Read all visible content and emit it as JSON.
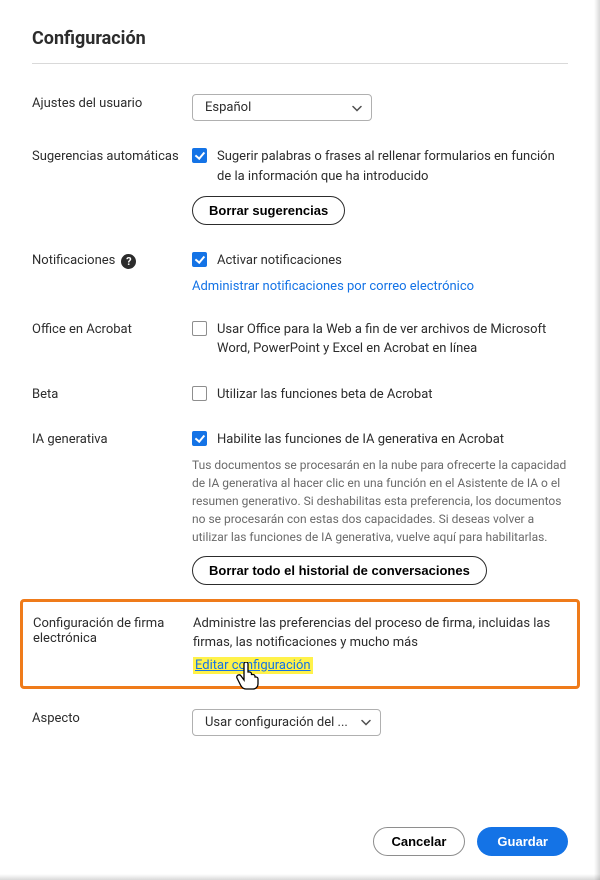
{
  "title": "Configuración",
  "userSettings": {
    "label": "Ajustes del usuario",
    "selected": "Español"
  },
  "autoSuggest": {
    "label": "Sugerencias automáticas",
    "checkboxLabel": "Sugerir palabras o frases al rellenar formularios en función de la información que ha introducido",
    "clearButton": "Borrar sugerencias"
  },
  "notifications": {
    "label": "Notificaciones",
    "checkboxLabel": "Activar notificaciones",
    "manageLink": "Administrar notificaciones por correo electrónico"
  },
  "office": {
    "label": "Office en Acrobat",
    "checkboxLabel": "Usar Office para la Web a fin de ver archivos de Microsoft Word, PowerPoint y Excel en Acrobat en línea"
  },
  "beta": {
    "label": "Beta",
    "checkboxLabel": "Utilizar las funciones beta de Acrobat"
  },
  "genAI": {
    "label": "IA generativa",
    "checkboxLabel": "Habilite las funciones de IA generativa en Acrobat",
    "description": "Tus documentos se procesarán en la nube para ofrecerte la capacidad de IA generativa al hacer clic en una función en el Asistente de IA o el resumen generativo. Si deshabilitas esta preferencia, los documentos no se procesarán con estas dos capacidades. Si deseas volver a utilizar las funciones de IA generativa, vuelve aquí para habilitarlas.",
    "clearButton": "Borrar todo el historial de conversaciones"
  },
  "esign": {
    "label": "Configuración de firma electrónica",
    "description": "Administre las preferencias del proceso de firma, incluidas las firmas, las notificaciones y mucho más",
    "editLink": "Editar configuración"
  },
  "appearance": {
    "label": "Aspecto",
    "selected": "Usar configuración del ..."
  },
  "footer": {
    "cancel": "Cancelar",
    "save": "Guardar"
  }
}
